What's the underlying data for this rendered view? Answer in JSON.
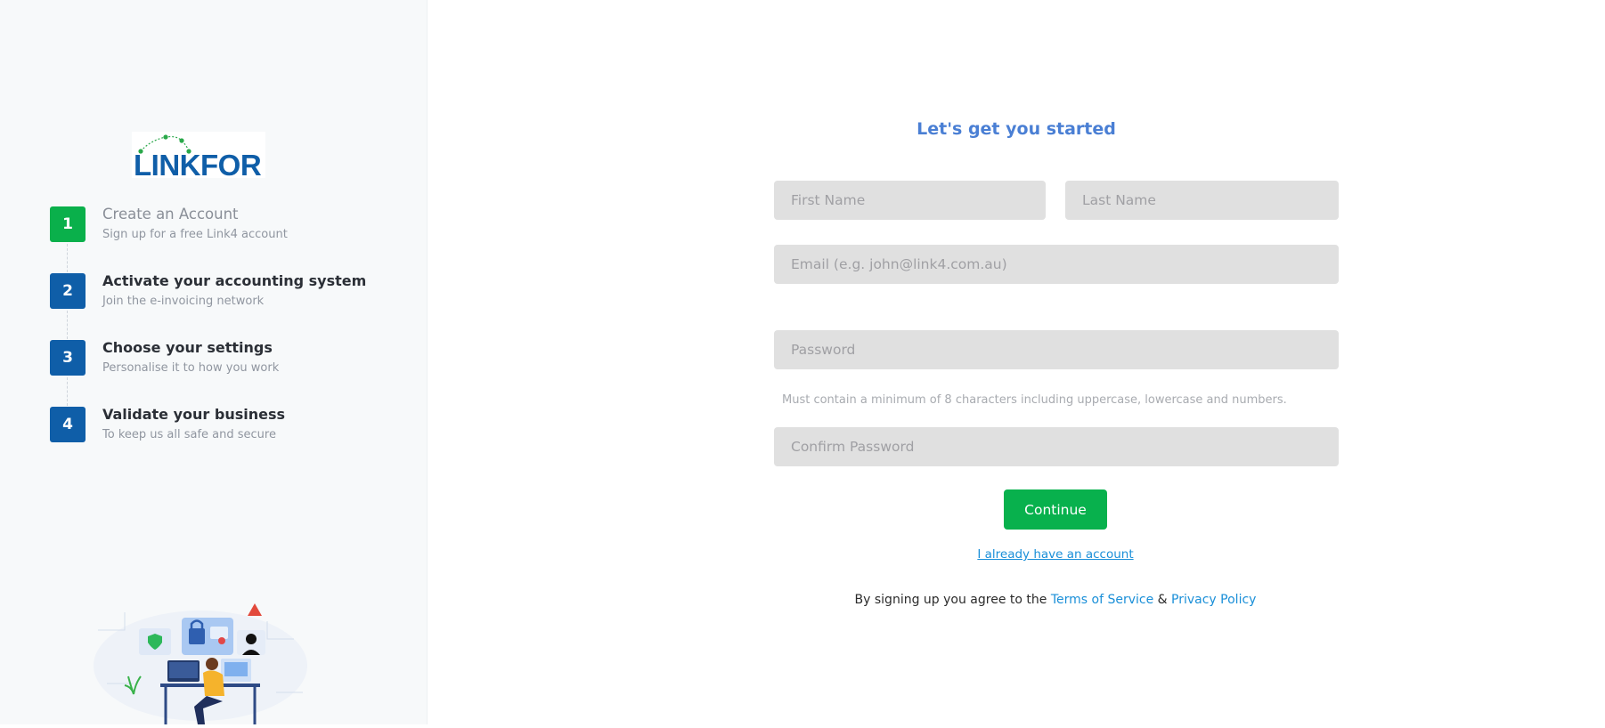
{
  "brand": {
    "logo_text": "LINKFOR",
    "logo_color": "#0f5ea8",
    "accent_green": "#0ab04b"
  },
  "steps": [
    {
      "number": "1",
      "title": "Create an Account",
      "subtitle": "Sign up for a free Link4 account",
      "state": "active"
    },
    {
      "number": "2",
      "title": "Activate your accounting system",
      "subtitle": "Join the e-invoicing network",
      "state": "pending"
    },
    {
      "number": "3",
      "title": "Choose your settings",
      "subtitle": "Personalise it to how you work",
      "state": "pending"
    },
    {
      "number": "4",
      "title": "Validate your business",
      "subtitle": "To keep us all safe and secure",
      "state": "pending"
    }
  ],
  "form": {
    "heading": "Let's get you started",
    "first_name_placeholder": "First Name",
    "last_name_placeholder": "Last Name",
    "email_placeholder": "Email (e.g. john@link4.com.au)",
    "password_placeholder": "Password",
    "password_hint": "Must contain a minimum of 8 characters including uppercase, lowercase and numbers.",
    "confirm_password_placeholder": "Confirm Password",
    "continue_label": "Continue",
    "login_link": "I already have an account",
    "terms_prefix": "By signing up you agree to the",
    "terms_link": "Terms of Service",
    "terms_amp": "&",
    "privacy_link": "Privacy Policy"
  }
}
